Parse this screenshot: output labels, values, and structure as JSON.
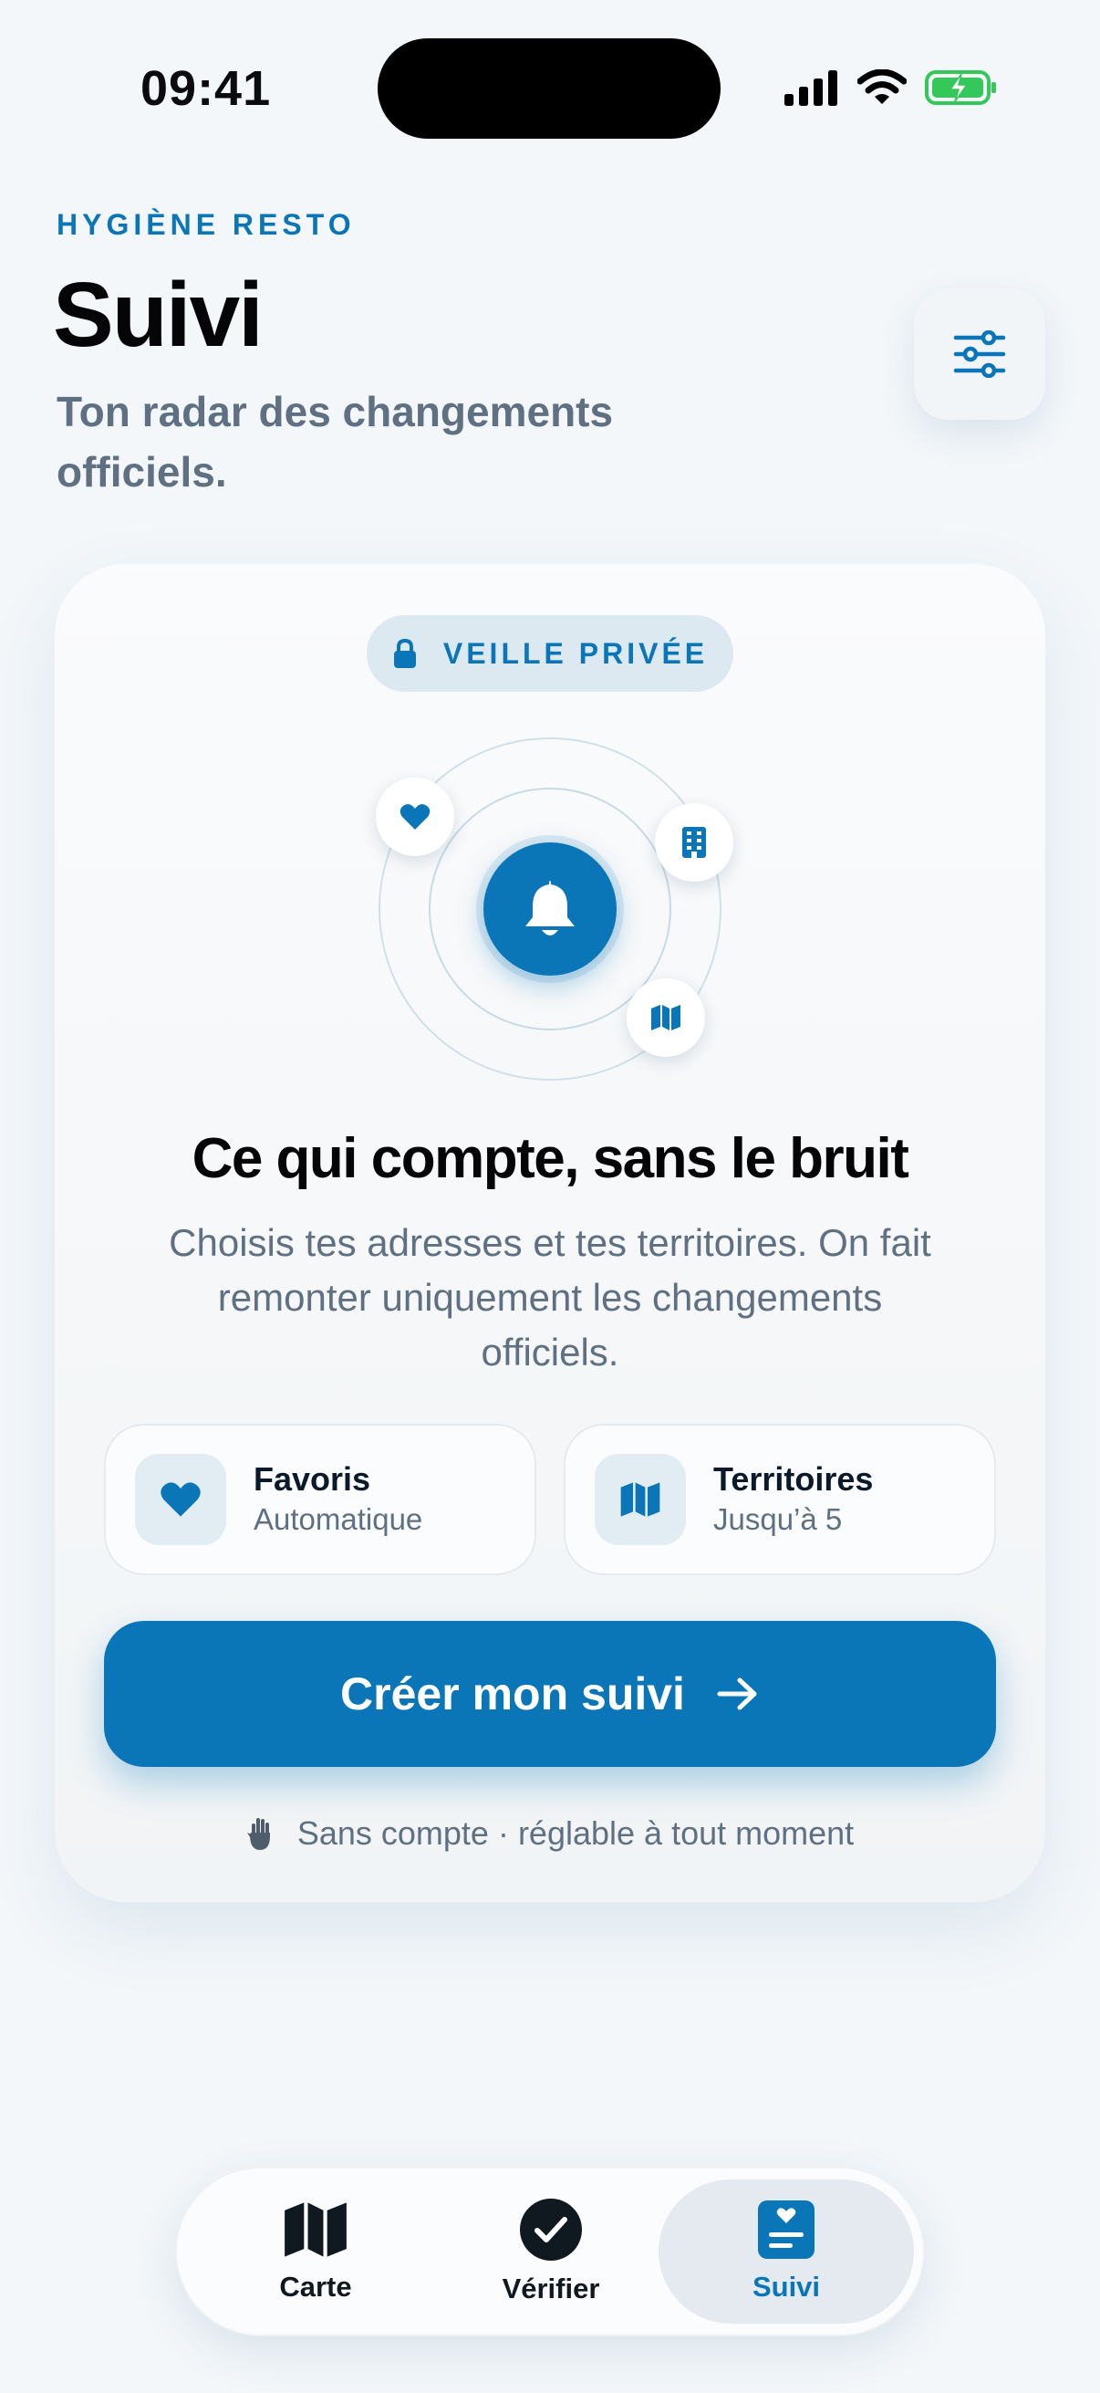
{
  "status_bar": {
    "time": "09:41"
  },
  "header": {
    "eyebrow": "HYGIÈNE RESTO",
    "title": "Suivi",
    "subtitle": "Ton radar des changements officiels."
  },
  "card": {
    "badge": "VEILLE PRIVÉE",
    "title": "Ce qui compte, sans le bruit",
    "body": "Choisis tes adresses et tes territoires. On fait remonter uniquement les changements officiels.",
    "features": [
      {
        "title": "Favoris",
        "subtitle": "Automatique",
        "icon": "heart-icon"
      },
      {
        "title": "Territoires",
        "subtitle": "Jusqu’à 5",
        "icon": "map-icon"
      }
    ],
    "cta_label": "Créer mon suivi",
    "footnote": "Sans compte · réglable à tout moment"
  },
  "tabs": [
    {
      "label": "Carte",
      "icon": "map-icon",
      "active": false
    },
    {
      "label": "Vérifier",
      "icon": "check-circle-icon",
      "active": false
    },
    {
      "label": "Suivi",
      "icon": "watchlist-icon",
      "active": true
    }
  ],
  "colors": {
    "accent": "#0a76b8",
    "background": "#f3f7fa",
    "muted_text": "#5e7082",
    "battery": "#34c759"
  }
}
